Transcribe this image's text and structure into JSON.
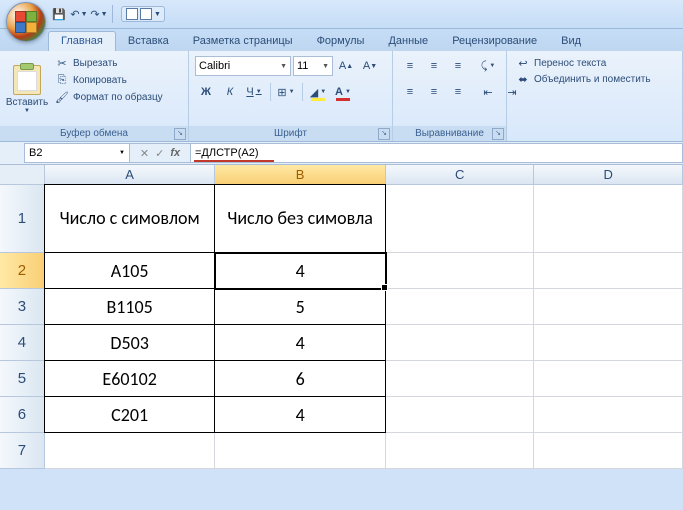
{
  "qat": {
    "save": "💾",
    "undo": "↶",
    "redo": "↷"
  },
  "tabs": {
    "t1": "Главная",
    "t2": "Вставка",
    "t3": "Разметка страницы",
    "t4": "Формулы",
    "t5": "Данные",
    "t6": "Рецензирование",
    "t7": "Вид"
  },
  "clip": {
    "paste": "Вставить",
    "cut": "Вырезать",
    "copy": "Копировать",
    "format": "Формат по образцу",
    "group": "Буфер обмена"
  },
  "font": {
    "name": "Calibri",
    "size": "11",
    "group": "Шрифт",
    "bold": "Ж",
    "italic": "К",
    "underline": "Ч"
  },
  "align": {
    "wrap": "Перенос текста",
    "merge": "Объединить и поместить",
    "group": "Выравнивание"
  },
  "fbar": {
    "ref": "B2",
    "formula": "=ДЛСТР(A2)"
  },
  "cols": {
    "A": "A",
    "B": "B",
    "C": "C",
    "D": "D"
  },
  "rows": {
    "r1": "1",
    "r2": "2",
    "r3": "3",
    "r4": "4",
    "r5": "5",
    "r6": "6",
    "r7": "7"
  },
  "cells": {
    "A1": "Число с симовлом",
    "B1": "Число без симовла",
    "A2": "А105",
    "B2": "4",
    "A3": "В1105",
    "B3": "5",
    "A4": "D503",
    "B4": "4",
    "A5": "Е60102",
    "B5": "6",
    "A6": "С201",
    "B6": "4"
  },
  "chart_data": {
    "type": "table",
    "title": "",
    "columns": [
      "Число с симовлом",
      "Число без симовла"
    ],
    "rows": [
      [
        "А105",
        4
      ],
      [
        "В1105",
        5
      ],
      [
        "D503",
        4
      ],
      [
        "Е60102",
        6
      ],
      [
        "С201",
        4
      ]
    ]
  }
}
